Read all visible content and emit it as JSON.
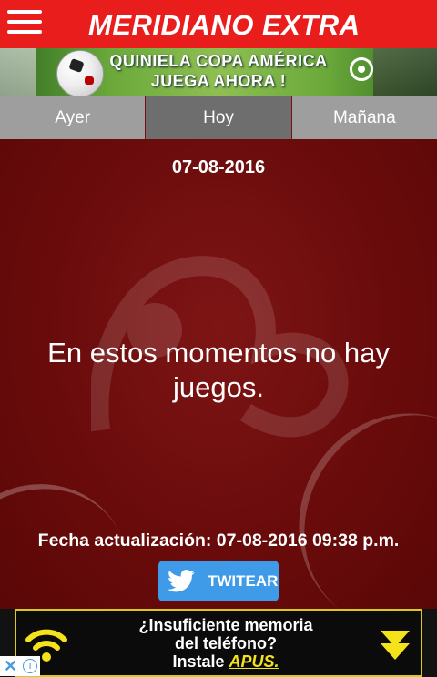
{
  "header": {
    "title": "MERIDIANO EXTRA",
    "menu_icon": "hamburger-menu-icon"
  },
  "banner": {
    "line1": "QUINIELA COPA AMÉRICA",
    "line2": "JUEGA AHORA !"
  },
  "tabs": [
    {
      "label": "Ayer",
      "active": false
    },
    {
      "label": "Hoy",
      "active": true
    },
    {
      "label": "Mañana",
      "active": false
    }
  ],
  "main": {
    "date": "07-08-2016",
    "message": "En estos momentos no hay juegos.",
    "updated": "Fecha actualización: 07-08-2016 09:38 p.m.",
    "tweet_label": "TWITEAR"
  },
  "ad": {
    "line1": "¿Insuficiente memoria",
    "line2": "del teléfono?",
    "line3_prefix": "Instale ",
    "line3_brand": "APUS."
  },
  "colors": {
    "header_red": "#ea1d1d",
    "content_red": "#7a0d0d",
    "twitter_blue": "#3f9ae8",
    "ad_yellow": "#f4e21a"
  }
}
